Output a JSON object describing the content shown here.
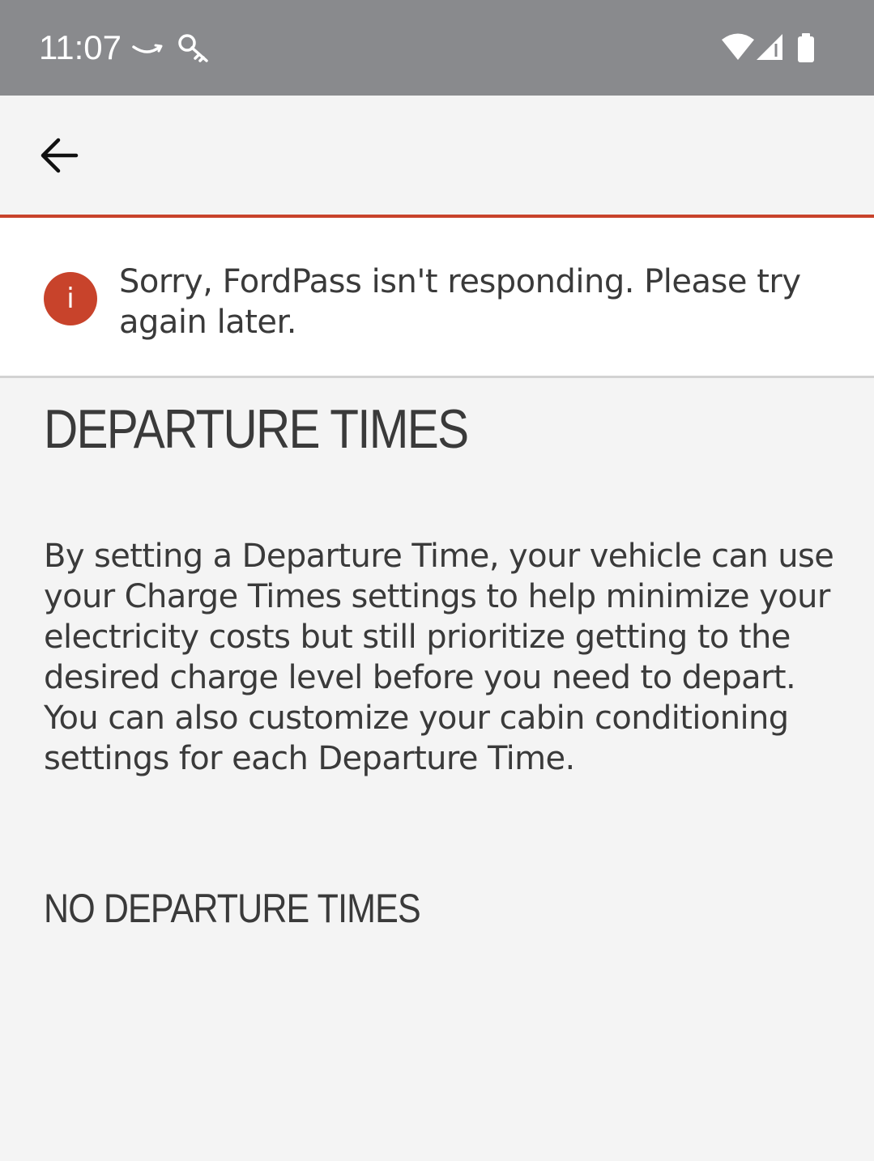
{
  "status_bar": {
    "time": "11:07",
    "icons": [
      "amazon-smile-icon",
      "key-icon",
      "wifi-icon",
      "cellular-signal-icon",
      "battery-icon"
    ]
  },
  "app_bar": {
    "back_icon": "arrow-left-icon",
    "accent_color": "#c8432b"
  },
  "error_banner": {
    "icon": "info-icon",
    "icon_glyph": "i",
    "message": "Sorry, FordPass isn't responding. Please try again later.",
    "icon_color": "#c8432b"
  },
  "main": {
    "title": "DEPARTURE TIMES",
    "description": "By setting a Departure Time, your vehicle can use your Charge Times settings to help minimize your electricity costs but still prioritize getting to the desired charge level before you need to depart. You can also customize your cabin conditioning settings for each Departure Time.",
    "empty_state": "NO DEPARTURE TIMES"
  }
}
